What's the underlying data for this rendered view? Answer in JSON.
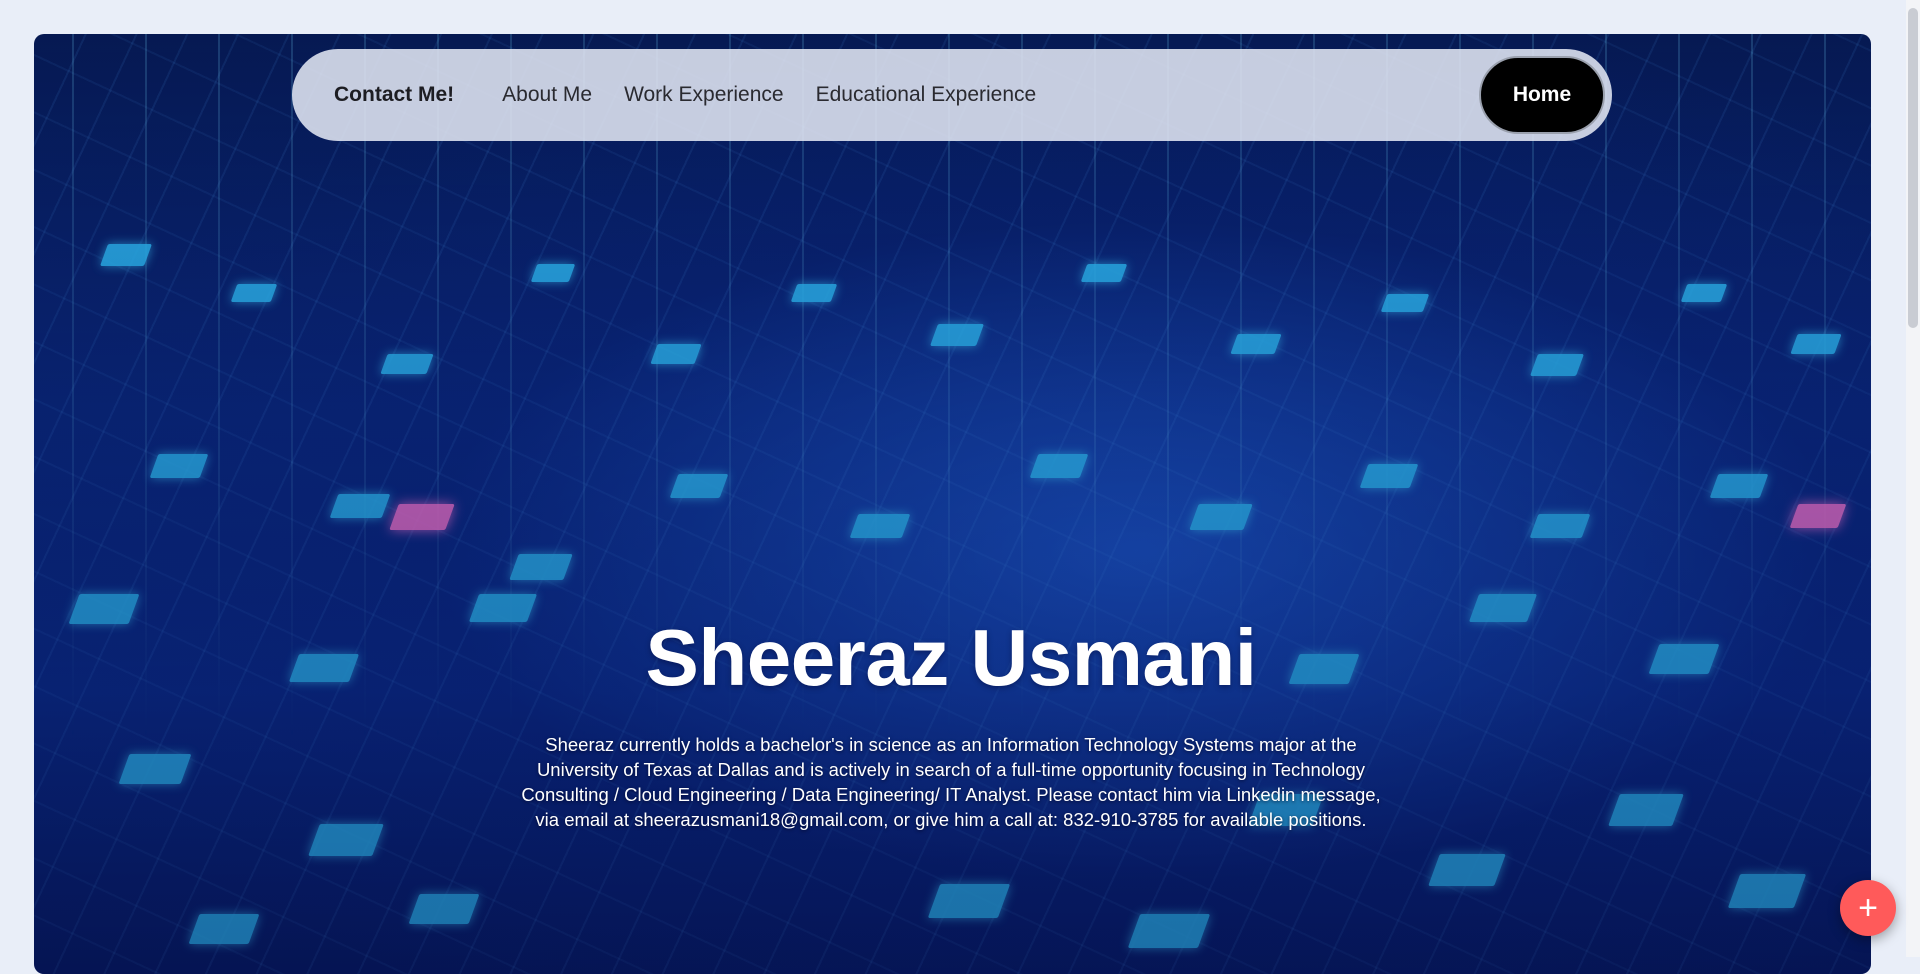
{
  "nav": {
    "brand": "Contact Me!",
    "links": [
      "About Me",
      "Work Experience",
      "Educational Experience"
    ],
    "home": "Home"
  },
  "hero": {
    "title": "Sheeraz Usmani",
    "description_lines": [
      "Sheeraz currently holds a bachelor's in science as an Information Technology Systems major at the",
      "University of Texas at Dallas and is actively in search of a full-time opportunity focusing in Technology",
      "Consulting / Cloud Engineering / Data Engineering/ IT Analyst. Please contact him via Linkedin message,",
      "via email at sheerazusmani18@gmail.com, or give him a call at: 832-910-3785 for available positions."
    ],
    "background_icon": "circuit-city-image"
  },
  "fab": {
    "icon": "plus-icon",
    "glyph": "+"
  },
  "colors": {
    "page_bg": "#e9eef8",
    "nav_bg": "#e1e6f2",
    "home_button": "#000000",
    "fab": "#ff5a5a",
    "hero_blue": "#0b2f8f"
  }
}
